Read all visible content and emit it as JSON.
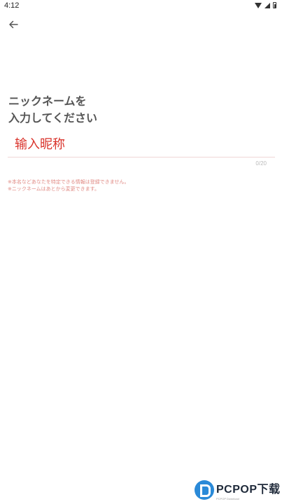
{
  "status_bar": {
    "time": "4:12",
    "icons": [
      "wifi-icon",
      "signal-icon",
      "battery-icon"
    ]
  },
  "header": {
    "back_icon": "arrow-left-icon"
  },
  "main": {
    "heading_line1": "ニックネームを",
    "heading_line2": "入力してください",
    "nickname_input": {
      "value": "",
      "placeholder": "输入昵称"
    },
    "counter": "0/20",
    "note1": "※本名などあなたを特定できる情報は登録できません。",
    "note2": "※ニックネームはあとから変更できます。"
  },
  "watermark": {
    "title": "PCPOP下载",
    "subtitle": "PCPOP Download"
  },
  "colors": {
    "placeholder": "#d9332b",
    "note": "#e08a84",
    "heading": "#555555",
    "watermark_blue": "#2a8ad8"
  }
}
